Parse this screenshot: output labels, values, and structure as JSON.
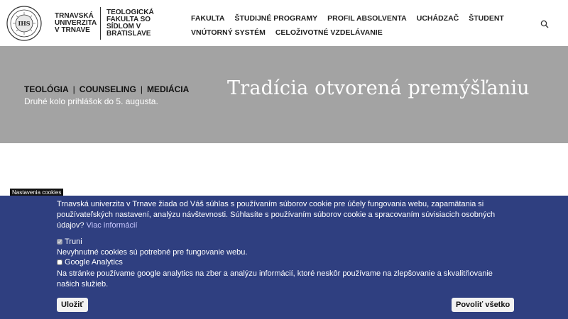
{
  "header": {
    "university_name": "Trnavská univerzita v Trnave",
    "faculty_name": "Teologická fakulta so sídlom v Bratislave",
    "nav_row1": [
      "FAKULTA",
      "ŠTUDIJNÉ PROGRAMY",
      "PROFIL ABSOLVENTA",
      "UCHÁDZAČ",
      "ŠTUDENT"
    ],
    "nav_row2": [
      "VNÚTORNÝ SYSTÉM",
      "CELOŽIVOTNÉ VZDELÁVANIE"
    ]
  },
  "hero": {
    "links": [
      "TEOLÓGIA",
      "COUNSELING",
      "MEDIÁCIA"
    ],
    "separator": "|",
    "note": "Druhé kolo prihlášok do 5. augusta.",
    "title": "Tradícia otvorená premýšľaniu"
  },
  "cookie": {
    "tab_label": "Nastavenia cookies",
    "text": "Trnavská univerzita v Trnave žiada od Váš súhlas s používaním súborov cookie pre účely fungovania webu, zapamätania si používateľských nastavení, analýzu návštevnosti. Súhlasíte s používaním súborov cookie a spracovaním súvisiacich osobných údajov?",
    "more_link": "Viac informácií",
    "options": [
      {
        "label": "Truni",
        "description": "Nevyhnutné cookies sú potrebné pre fungovanie webu.",
        "checked": true,
        "disabled": true
      },
      {
        "label": "Google Analytics",
        "description": "Na stránke používame google analytics na zber a analýzu informácií, ktoré neskôr používame na zlepšovanie a skvalitňovanie našich služieb.",
        "checked": false,
        "disabled": false
      }
    ],
    "save_label": "Uložiť",
    "allow_all_label": "Povoliť všetko"
  },
  "colors": {
    "banner_bg": "#2f3f80",
    "hero_bg": "#a3a3a3"
  }
}
